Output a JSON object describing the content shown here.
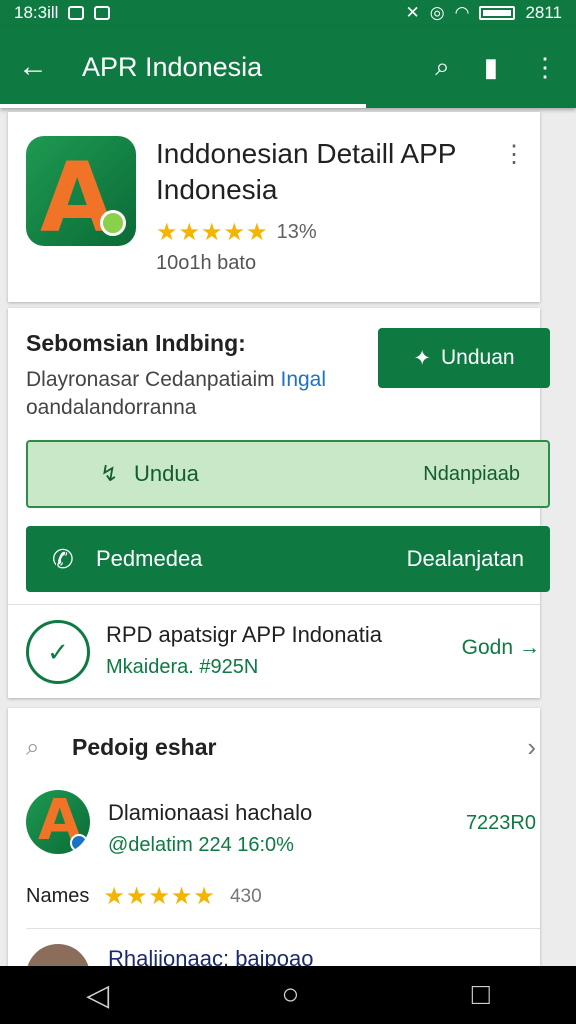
{
  "status_bar": {
    "time_left": "18:3ill",
    "time_right": "2811"
  },
  "app_bar": {
    "title": "APR Indonesia",
    "back_icon": "arrow-left-icon",
    "search_icon": "search-icon",
    "share_icon": "bookmark-icon",
    "menu_icon": "more-vert-icon"
  },
  "app_card": {
    "name": "Inddonesian Detaill APP Indonesia",
    "rating_stars": "★★★★★",
    "rating_value": "13%",
    "subtitle": "10o1h bato"
  },
  "section": {
    "title": "Sebomsian Indbing:",
    "description": "Dlayronasar Cedanpatiaim",
    "description_link": "Ingal",
    "description_tail": "oandalandorranna",
    "download_label": "Unduan",
    "light_button_label": "Undua",
    "light_button_right": "Ndanpiaab",
    "dark_button_label": "Pedmedea",
    "dark_button_right": "Dealanjatan",
    "row_title": "RPD apatsigr APP Indonatia",
    "row_subtitle": "Mkaidera. #925Ν",
    "row_action": "Godn"
  },
  "search_section": {
    "title": "Pedoig eshar",
    "item_title": "Dlamionaasi hachalo",
    "item_subtitle": "@delatim 224 16:0%",
    "item_value": "7223R0",
    "names_label": "Names",
    "names_stars": "★★★★★",
    "names_value": "430",
    "item2_title": "Rhaljionaac: baipoao"
  },
  "colors": {
    "primary": "#0e7a42",
    "accent_orange": "#f07328",
    "star": "#f4b400",
    "light_green": "#c9e8c8"
  }
}
